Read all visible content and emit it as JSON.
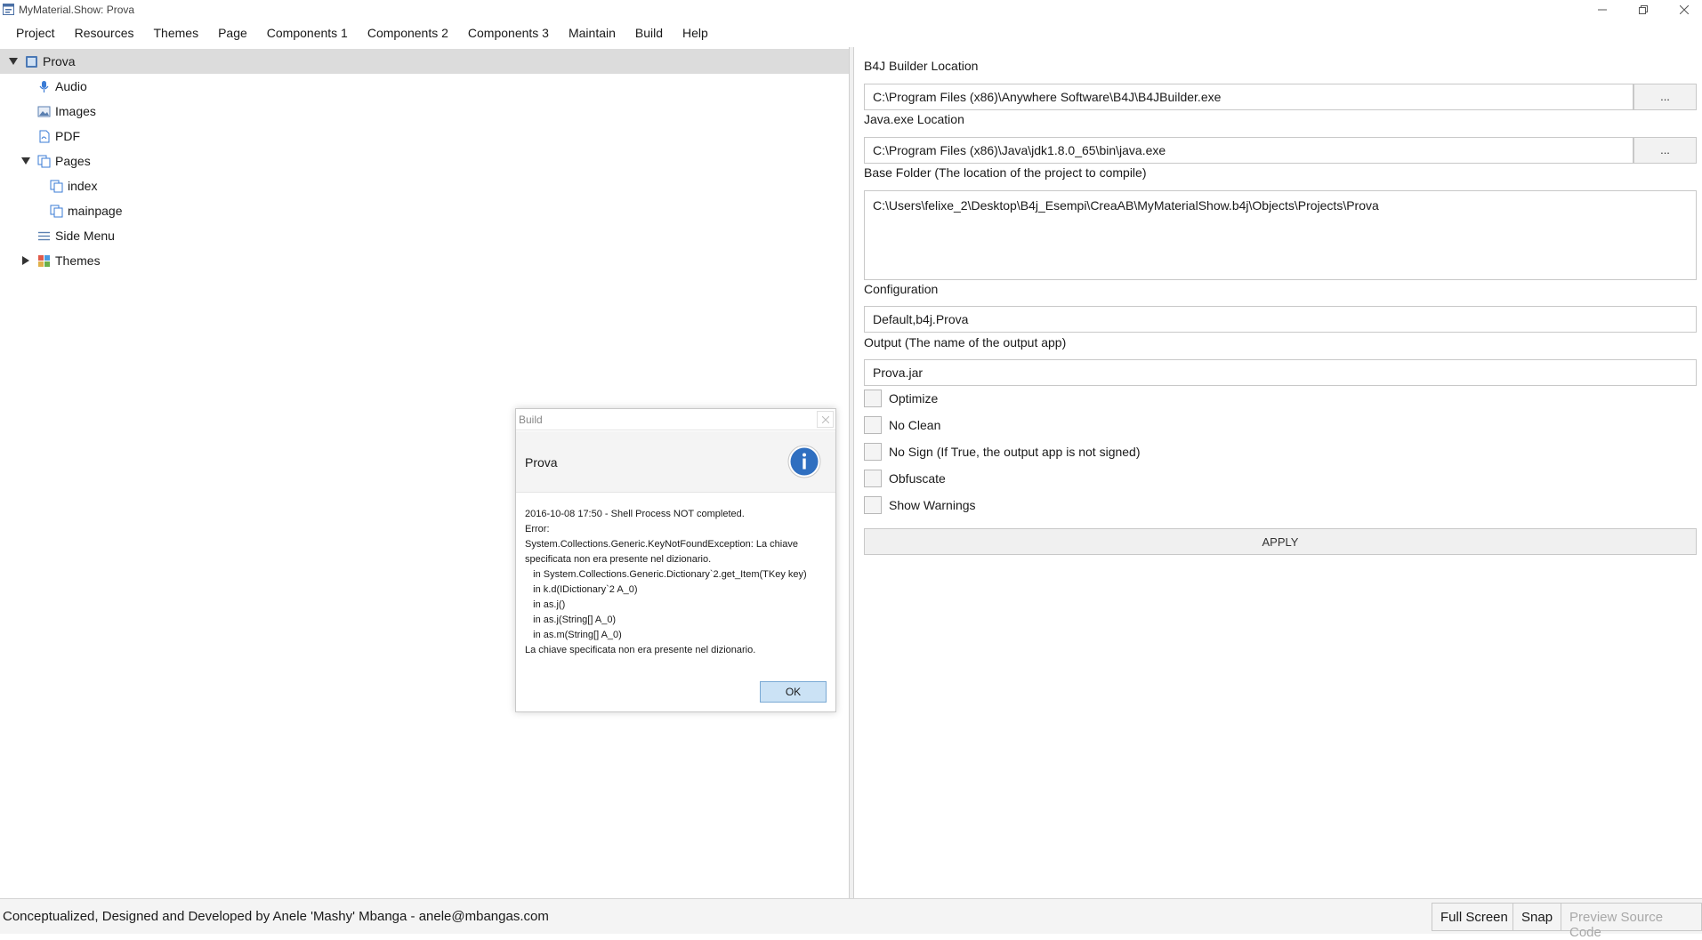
{
  "window": {
    "title": "MyMaterial.Show: Prova",
    "app_icon": "app-window-icon",
    "controls": [
      "minimize-icon",
      "restore-icon",
      "close-icon"
    ]
  },
  "menu": [
    "Project",
    "Resources",
    "Themes",
    "Page",
    "Components 1",
    "Components 2",
    "Components 3",
    "Maintain",
    "Build",
    "Help"
  ],
  "tree": {
    "root": "Prova",
    "items": [
      {
        "label": "Audio",
        "icon": "microphone-icon"
      },
      {
        "label": "Images",
        "icon": "image-icon"
      },
      {
        "label": "PDF",
        "icon": "pdf-file-icon"
      },
      {
        "label": "Pages",
        "icon": "pages-icon"
      },
      {
        "label": "index",
        "icon": "page-icon"
      },
      {
        "label": "mainpage",
        "icon": "page-icon"
      },
      {
        "label": "Side Menu",
        "icon": "menu-lines-icon"
      },
      {
        "label": "Themes",
        "icon": "themes-grid-icon"
      }
    ]
  },
  "form": {
    "builder_label": "B4J Builder Location",
    "builder_value": "C:\\Program Files (x86)\\Anywhere Software\\B4J\\B4JBuilder.exe",
    "java_label": "Java.exe Location",
    "java_value": "C:\\Program Files (x86)\\Java\\jdk1.8.0_65\\bin\\java.exe",
    "browse_label": "...",
    "base_label": "Base Folder (The location of the project to compile)",
    "base_value": "C:\\Users\\felixe_2\\Desktop\\B4j_Esempi\\CreaAB\\MyMaterialShow.b4j\\Objects\\Projects\\Prova",
    "config_label": "Configuration",
    "config_value": "Default,b4j.Prova",
    "output_label": "Output (The name of the output app)",
    "output_value": "Prova.jar",
    "checkboxes": [
      {
        "label": "Optimize",
        "checked": false
      },
      {
        "label": "No Clean",
        "checked": false
      },
      {
        "label": "No Sign (If True, the output app is not signed)",
        "checked": false
      },
      {
        "label": "Obfuscate",
        "checked": false
      },
      {
        "label": "Show Warnings",
        "checked": false
      }
    ],
    "apply_label": "APPLY"
  },
  "dialog": {
    "title": "Build",
    "header": "Prova",
    "info_icon": "info-icon",
    "body": "2016-10-08 17:50 - Shell Process NOT completed.\nError:\nSystem.Collections.Generic.KeyNotFoundException: La chiave\nspecificata non era presente nel dizionario.\n   in System.Collections.Generic.Dictionary`2.get_Item(TKey key)\n   in k.d(IDictionary`2 A_0)\n   in as.j()\n   in as.j(String[] A_0)\n   in as.m(String[] A_0)\nLa chiave specificata non era presente nel dizionario.",
    "ok_label": "OK"
  },
  "statusbar": {
    "text": "Conceptualized, Designed and Developed by Anele 'Mashy' Mbanga - anele@mbangas.com",
    "full_screen": "Full Screen",
    "snap": "Snap",
    "preview_source": "Preview Source Code"
  },
  "colors": {
    "selection": "#dcdcdc",
    "info_blue": "#2f6fc0",
    "ok_button": "#cbe2f5"
  }
}
